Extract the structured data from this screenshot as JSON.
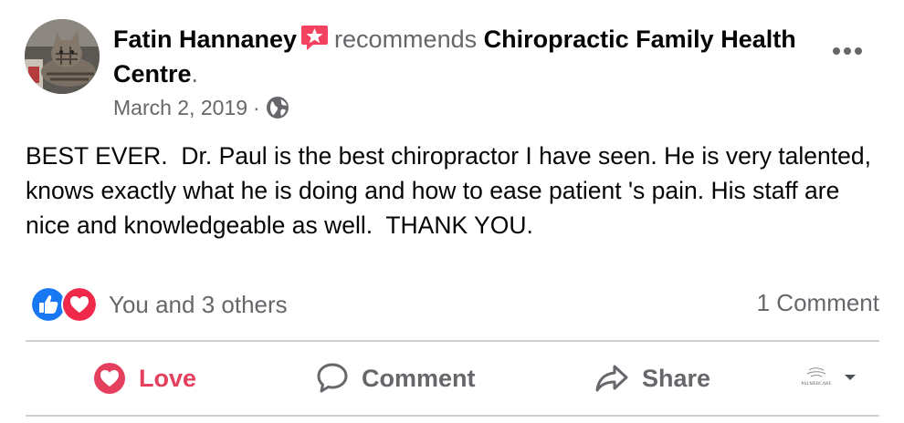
{
  "post": {
    "author": "Fatin Hannaney",
    "verb": "recommends",
    "page_name": "Chiropractic Family Health Centre",
    "period": ".",
    "date": "March 2, 2019",
    "date_separator": "·",
    "privacy_icon": "globe-icon",
    "more_icon": "more-horizontal-icon",
    "body": "BEST EVER.  Dr. Paul is the best chiropractor I have seen. He is very talented, knows exactly what he is doing and how to ease patient 's pain. His staff are nice and knowledgeable as well.  THANK YOU."
  },
  "reactions": {
    "icons": [
      "like-icon",
      "love-icon"
    ],
    "summary": "You and 3 others",
    "comment_count": "1 Comment"
  },
  "actions": {
    "love_label": "Love",
    "comment_label": "Comment",
    "share_label": "Share"
  },
  "page_logo_text": "PALMERCARE",
  "colors": {
    "love_red": "#e4405e",
    "like_blue": "#1877f2",
    "muted_text": "#65676b",
    "recommend_badge": "#f3425f",
    "divider": "#ced0d4"
  }
}
